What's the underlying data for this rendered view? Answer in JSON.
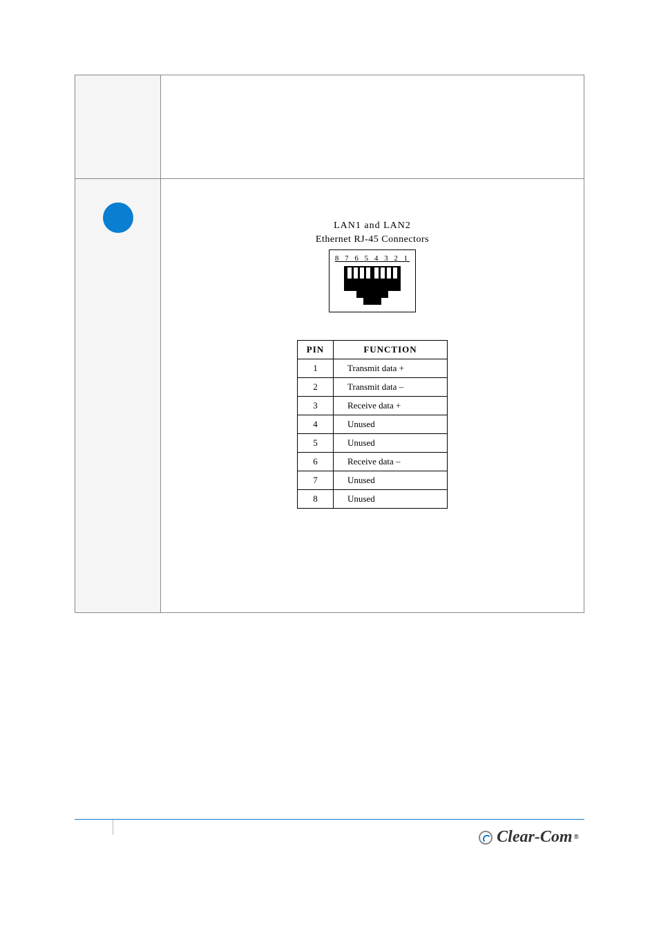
{
  "diagram": {
    "title_line1": "LAN1 and LAN2",
    "title_line2": "Ethernet RJ-45 Connectors",
    "pin_label_strip": "8 7 6 5 4 3 2 1"
  },
  "pin_table": {
    "headers": {
      "pin": "PIN",
      "function": "FUNCTION"
    },
    "rows": [
      {
        "pin": "1",
        "function": "Transmit data +"
      },
      {
        "pin": "2",
        "function": "Transmit data –"
      },
      {
        "pin": "3",
        "function": "Receive data +"
      },
      {
        "pin": "4",
        "function": "Unused"
      },
      {
        "pin": "5",
        "function": "Unused"
      },
      {
        "pin": "6",
        "function": "Receive data –"
      },
      {
        "pin": "7",
        "function": "Unused"
      },
      {
        "pin": "8",
        "function": "Unused"
      }
    ]
  },
  "footer": {
    "brand": "Clear-Com",
    "trademark": "®"
  },
  "chart_data": {
    "type": "table",
    "title": "RJ-45 pin functions",
    "columns": [
      "PIN",
      "FUNCTION"
    ],
    "rows": [
      [
        1,
        "Transmit data +"
      ],
      [
        2,
        "Transmit data -"
      ],
      [
        3,
        "Receive data +"
      ],
      [
        4,
        "Unused"
      ],
      [
        5,
        "Unused"
      ],
      [
        6,
        "Receive data -"
      ],
      [
        7,
        "Unused"
      ],
      [
        8,
        "Unused"
      ]
    ]
  }
}
